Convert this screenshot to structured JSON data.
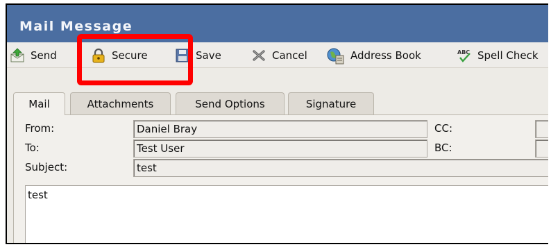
{
  "window": {
    "title": "Mail Message"
  },
  "toolbar": {
    "send": "Send",
    "secure": "Secure",
    "save": "Save",
    "cancel": "Cancel",
    "address_book": "Address Book",
    "spell_check": "Spell Check"
  },
  "tabs": [
    {
      "label": "Mail",
      "active": true
    },
    {
      "label": "Attachments",
      "active": false
    },
    {
      "label": "Send Options",
      "active": false
    },
    {
      "label": "Signature",
      "active": false
    }
  ],
  "form": {
    "from_label": "From:",
    "from_value": "Daniel Bray",
    "to_label": "To:",
    "to_value": "Test User",
    "cc_label": "CC:",
    "cc_value": "",
    "bc_label": "BC:",
    "bc_value": "",
    "subject_label": "Subject:",
    "subject_value": "test",
    "body": "test"
  },
  "colors": {
    "titlebar": "#4b6ea1",
    "highlight": "#ff0000"
  },
  "icons": {
    "send": "send-mail-icon",
    "secure": "padlock-icon",
    "save": "floppy-disk-icon",
    "cancel": "cancel-x-icon",
    "address_book": "globe-address-book-icon",
    "spell_check": "spell-check-abc-icon"
  }
}
